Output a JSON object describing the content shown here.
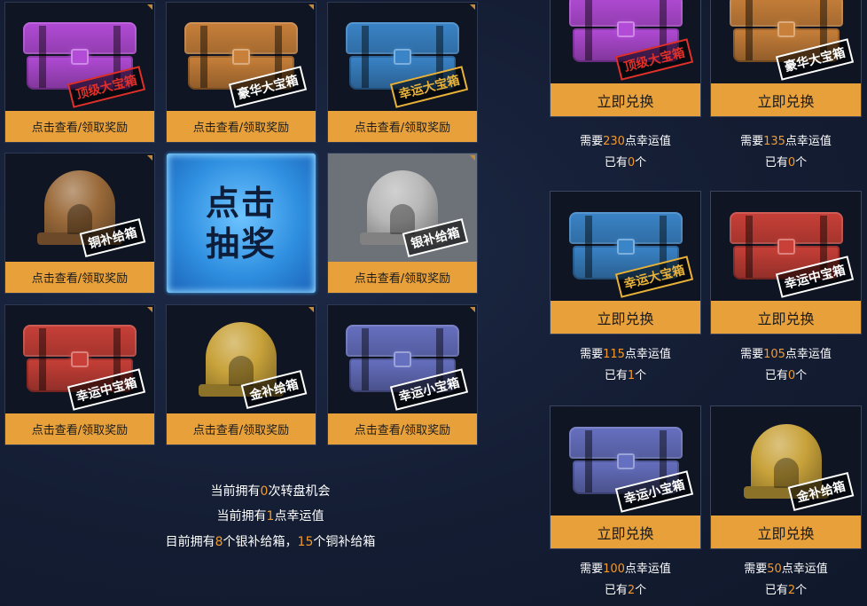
{
  "grid_action_label": "点击查看/领取奖励",
  "draw_button": {
    "line1": "点击",
    "line2": "抽奖"
  },
  "left_grid": [
    {
      "label": "顶级大宝箱",
      "kind": "chest",
      "color": "#b24bd6",
      "stamp_color": "#e0302a"
    },
    {
      "label": "豪华大宝箱",
      "kind": "chest",
      "color": "#c8803a",
      "stamp_color": "#ffffff"
    },
    {
      "label": "幸运大宝箱",
      "kind": "chest",
      "color": "#3a84c8",
      "stamp_color": "#e8b23a"
    },
    {
      "label": "铜补给箱",
      "kind": "capsule",
      "color": "#9a6a3a",
      "stamp_color": "#ffffff"
    },
    {
      "label": "银补给箱",
      "kind": "capsule",
      "color": "#b8b8b8",
      "stamp_color": "#ffffff"
    },
    {
      "label": "幸运中宝箱",
      "kind": "chest",
      "color": "#c84038",
      "stamp_color": "#ffffff"
    },
    {
      "label": "金补给箱",
      "kind": "capsule",
      "color": "#c8a23a",
      "stamp_color": "#ffffff"
    },
    {
      "label": "幸运小宝箱",
      "kind": "chest",
      "color": "#6670c0",
      "stamp_color": "#ffffff"
    }
  ],
  "status": {
    "line1": {
      "prefix": "当前拥有",
      "value": "0",
      "suffix": "次转盘机会"
    },
    "line2": {
      "prefix": "当前拥有",
      "value": "1",
      "suffix": "点幸运值"
    },
    "line3": {
      "prefix": "目前拥有",
      "value1": "8",
      "mid": "个银补给箱，",
      "value2": "15",
      "suffix": "个铜补给箱"
    }
  },
  "exchange_label": "立即兑换",
  "need_prefix": "需要",
  "need_suffix": "点幸运值",
  "own_prefix": "已有",
  "own_suffix": "个",
  "exchange": [
    {
      "label": "顶级大宝箱",
      "kind": "chest",
      "color": "#b24bd6",
      "stamp_color": "#e0302a",
      "cost": "230",
      "owned": "0"
    },
    {
      "label": "豪华大宝箱",
      "kind": "chest",
      "color": "#c8803a",
      "stamp_color": "#ffffff",
      "cost": "135",
      "owned": "0"
    },
    {
      "label": "幸运大宝箱",
      "kind": "chest",
      "color": "#3a84c8",
      "stamp_color": "#e8b23a",
      "cost": "115",
      "owned": "1"
    },
    {
      "label": "幸运中宝箱",
      "kind": "chest",
      "color": "#c84038",
      "stamp_color": "#ffffff",
      "cost": "105",
      "owned": "0"
    },
    {
      "label": "幸运小宝箱",
      "kind": "chest",
      "color": "#6670c0",
      "stamp_color": "#ffffff",
      "cost": "100",
      "owned": "2"
    },
    {
      "label": "金补给箱",
      "kind": "capsule",
      "color": "#c8a23a",
      "stamp_color": "#ffffff",
      "cost": "50",
      "owned": "2"
    }
  ]
}
